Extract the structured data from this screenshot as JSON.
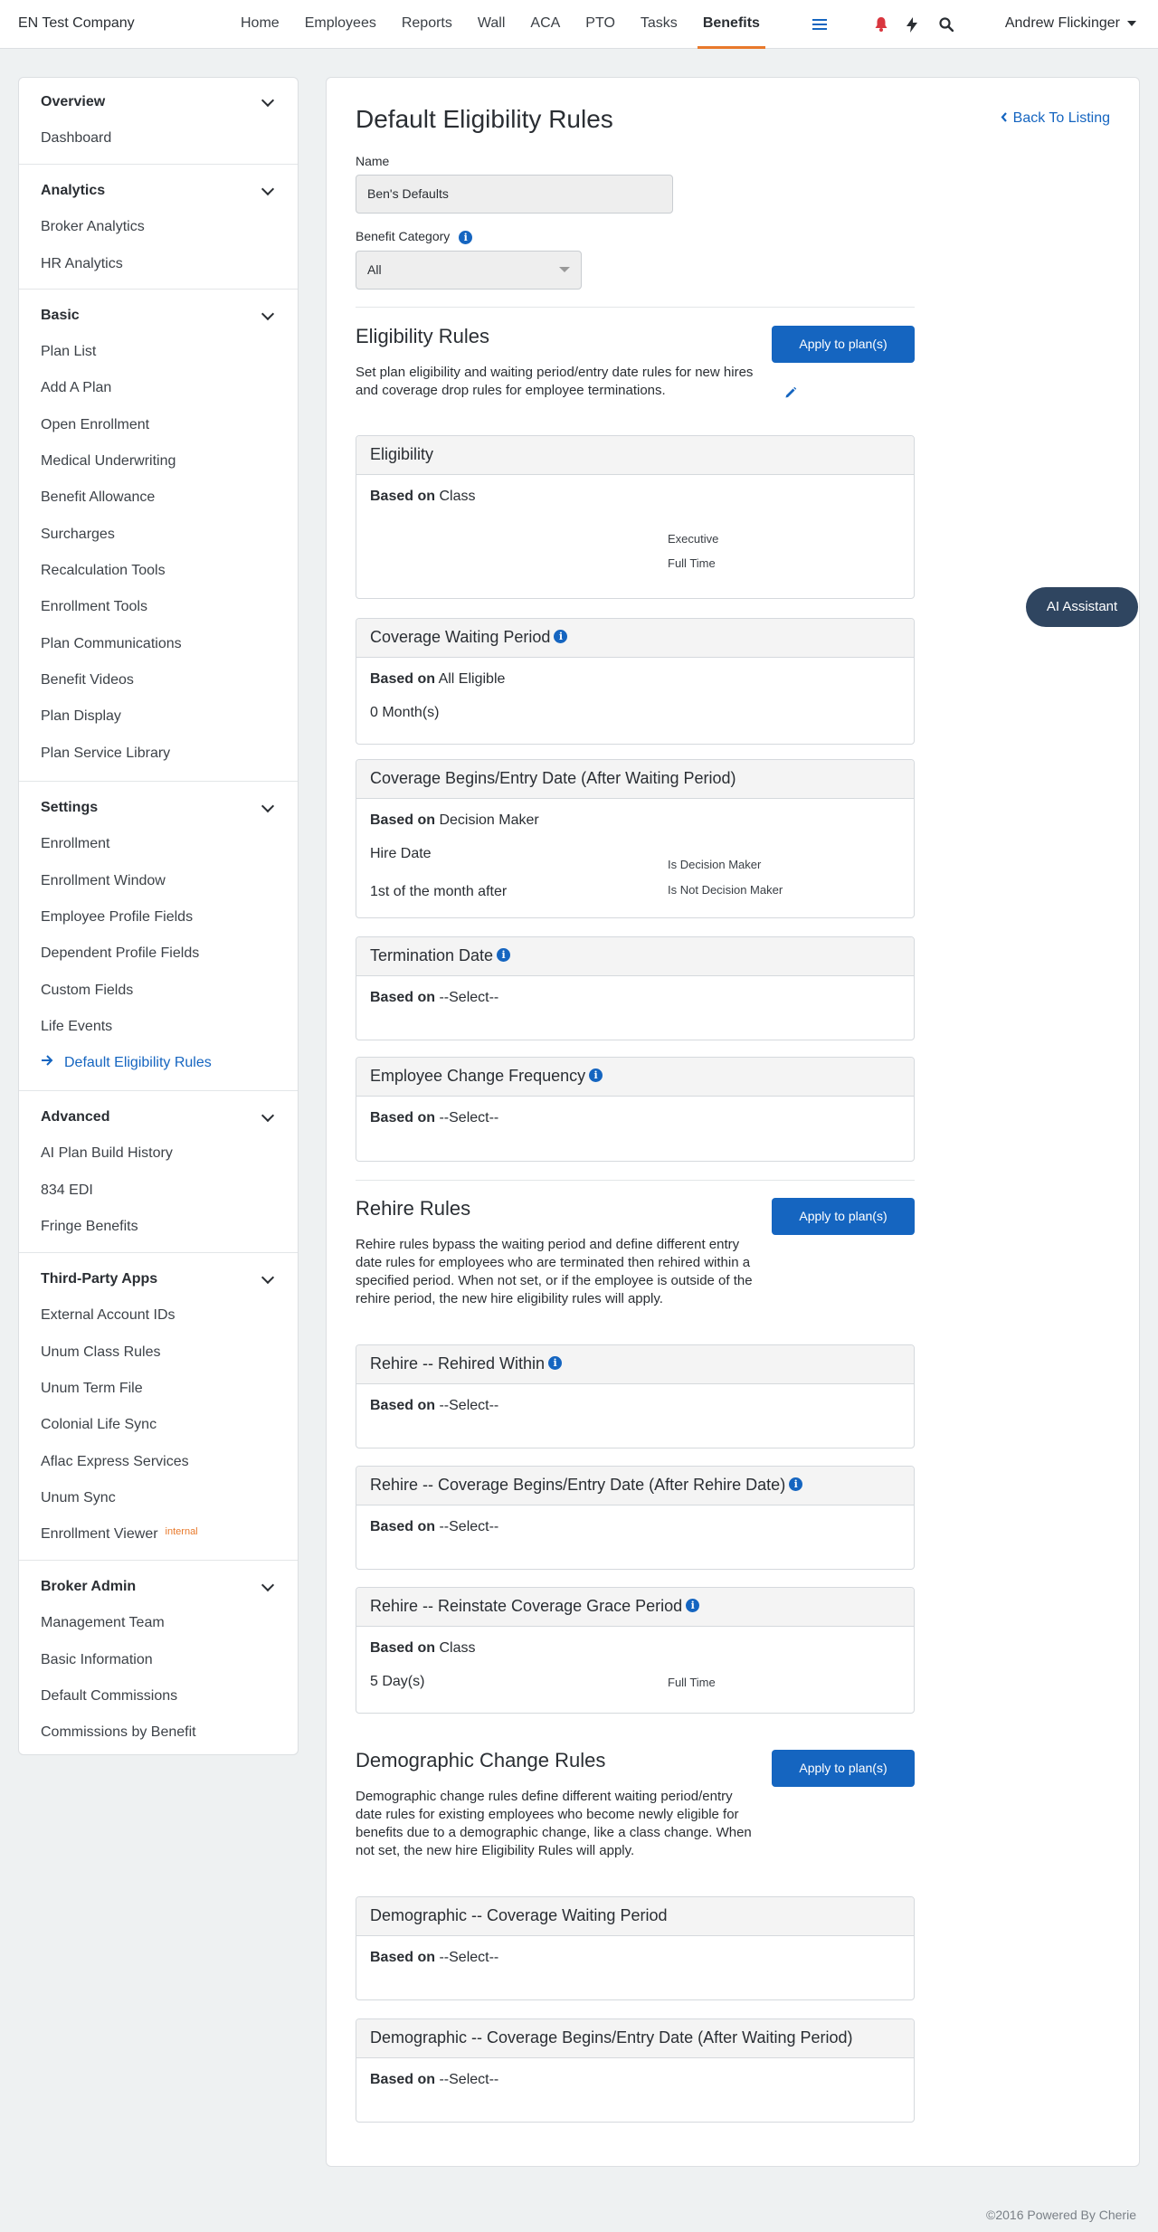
{
  "brand": "EN Test Company",
  "nav": [
    "Home",
    "Employees",
    "Reports",
    "Wall",
    "ACA",
    "PTO",
    "Tasks",
    "Benefits"
  ],
  "nav_active": "Benefits",
  "user": "Andrew Flickinger",
  "icons": {
    "menu": "menu-icon",
    "bell": "bell-icon",
    "bolt": "bolt-icon",
    "search": "search-icon"
  },
  "sidebar": {
    "overview": {
      "title": "Overview",
      "items": [
        "Dashboard"
      ]
    },
    "analytics": {
      "title": "Analytics",
      "items": [
        "Broker Analytics",
        "HR Analytics"
      ]
    },
    "basic": {
      "title": "Basic",
      "items": [
        "Plan List",
        "Add A Plan",
        "Open Enrollment",
        "Medical Underwriting",
        "Benefit Allowance",
        "Surcharges",
        "Recalculation Tools",
        "Enrollment Tools",
        "Plan Communications",
        "Benefit Videos",
        "Plan Display",
        "Plan Service Library"
      ]
    },
    "settings": {
      "title": "Settings",
      "items": [
        "Enrollment",
        "Enrollment Window",
        "Employee Profile Fields",
        "Dependent Profile Fields",
        "Custom Fields",
        "Life Events",
        "Default Eligibility Rules"
      ]
    },
    "advanced": {
      "title": "Advanced",
      "items": [
        "AI Plan Build History",
        "834 EDI",
        "Fringe Benefits"
      ]
    },
    "third_party": {
      "title": "Third-Party Apps",
      "items": [
        "External Account IDs",
        "Unum Class Rules",
        "Unum Term File",
        "Colonial Life Sync",
        "Aflac Express Services",
        "Unum Sync",
        "Enrollment Viewer"
      ],
      "internal_badge": "internal"
    },
    "broker_admin": {
      "title": "Broker Admin",
      "items": [
        "Management Team",
        "Basic Information",
        "Default Commissions",
        "Commissions by Benefit"
      ]
    }
  },
  "main": {
    "title": "Default Eligibility Rules",
    "back_link": "Back To Listing",
    "name_label": "Name",
    "name_value": "Ben's Defaults",
    "category_label": "Benefit Category",
    "category_value": "All",
    "based_on": "Based on",
    "apply_label": "Apply to plan(s)",
    "eligibility": {
      "title": "Eligibility Rules",
      "desc": "Set plan eligibility and waiting period/entry date rules for new hires and coverage drop rules for employee terminations.",
      "cards": [
        {
          "title": "Eligibility",
          "based": "Class",
          "side": [
            "Executive",
            "Full Time"
          ]
        },
        {
          "title": "Coverage Waiting Period",
          "based": "All Eligible",
          "value": "0 Month(s)"
        },
        {
          "title": "Coverage Begins/Entry Date (After Waiting Period)",
          "based": "Decision Maker",
          "value1": "Hire Date",
          "value2": "1st of the month after",
          "side": [
            "Is Decision Maker",
            "Is Not Decision Maker"
          ]
        },
        {
          "title": "Termination Date",
          "based": "--Select--"
        },
        {
          "title": "Employee Change Frequency",
          "based": "--Select--"
        }
      ]
    },
    "rehire": {
      "title": "Rehire Rules",
      "desc": "Rehire rules bypass the waiting period and define different entry date rules for employees who are terminated then rehired within a specified period. When not set, or if the employee is outside of the rehire period, the new hire eligibility rules will apply.",
      "cards": [
        {
          "title": "Rehire -- Rehired Within",
          "based": "--Select--"
        },
        {
          "title": "Rehire -- Coverage Begins/Entry Date (After Rehire Date)",
          "based": "--Select--"
        },
        {
          "title": "Rehire -- Reinstate Coverage Grace Period",
          "based": "Class",
          "value": "5 Day(s)",
          "side": [
            "Full Time"
          ]
        }
      ]
    },
    "demographic": {
      "title": "Demographic Change Rules",
      "desc": "Demographic change rules define different waiting period/entry date rules for existing employees who become newly eligible for benefits due to a demographic change, like a class change. When not set, the new hire Eligibility Rules will apply.",
      "cards": [
        {
          "title": "Demographic -- Coverage Waiting Period",
          "based": "--Select--"
        },
        {
          "title": "Demographic -- Coverage Begins/Entry Date (After Waiting Period)",
          "based": "--Select--"
        }
      ]
    }
  },
  "ai_assistant": "AI Assistant",
  "footer": "©2016 Powered By Cherie",
  "colors": {
    "accent": "#1565c0",
    "nav_active_underline": "#e8792b",
    "ai_button": "#2f4560"
  }
}
